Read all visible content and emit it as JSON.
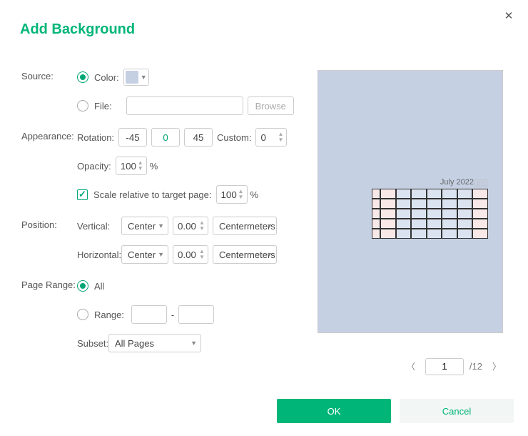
{
  "title": "Add Background",
  "accent_color": "#00b578",
  "preview_bg": "#c5d0e3",
  "color_swatch": "#c5d0e3",
  "source": {
    "label": "Source:",
    "color_label": "Color:",
    "color_selected": true,
    "file_label": "File:",
    "file_value": "",
    "browse_label": "Browse"
  },
  "appearance": {
    "label": "Appearance:",
    "rotation_label": "Rotation:",
    "rotation_presets": [
      "-45",
      "0",
      "45"
    ],
    "custom_label": "Custom:",
    "custom_value": "0",
    "opacity_label": "Opacity:",
    "opacity_value": "100",
    "percent": "%",
    "scale_label": "Scale relative to target page:",
    "scale_checked": true,
    "scale_value": "100"
  },
  "position": {
    "label": "Position:",
    "vertical_label": "Vertical:",
    "vertical_align": "Center",
    "vertical_value": "0.00",
    "vertical_unit": "Centermeters",
    "horizontal_label": "Horizontal:",
    "horizontal_align": "Center",
    "horizontal_value": "0.00",
    "horizontal_unit": "Centermeters"
  },
  "page_range": {
    "label": "Page Range:",
    "all_label": "All",
    "all_selected": true,
    "range_label": "Range:",
    "range_sep": "-",
    "range_from": "",
    "range_to": "",
    "subset_label": "Subset:",
    "subset_value": "All Pages"
  },
  "preview": {
    "doc_title": "July 2022"
  },
  "pager": {
    "current": "1",
    "total": "/12"
  },
  "buttons": {
    "ok": "OK",
    "cancel": "Cancel"
  }
}
